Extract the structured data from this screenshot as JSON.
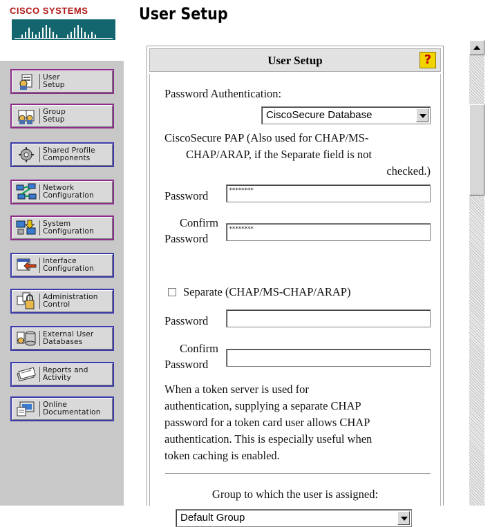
{
  "brand": {
    "name": "Cisco Systems"
  },
  "page_title": "User Setup",
  "nav": {
    "items": [
      {
        "label": "User\nSetup",
        "icon": "user-setup-icon"
      },
      {
        "label": "Group\nSetup",
        "icon": "group-setup-icon"
      },
      {
        "label": "Shared Profile\nComponents",
        "icon": "shared-profile-icon"
      },
      {
        "label": "Network\nConfiguration",
        "icon": "network-config-icon"
      },
      {
        "label": "System\nConfiguration",
        "icon": "system-config-icon"
      },
      {
        "label": "Interface\nConfiguration",
        "icon": "interface-config-icon"
      },
      {
        "label": "Administration\nControl",
        "icon": "admin-control-icon"
      },
      {
        "label": "External User\nDatabases",
        "icon": "external-db-icon"
      },
      {
        "label": "Reports and\nActivity",
        "icon": "reports-icon"
      },
      {
        "label": "Online\nDocumentation",
        "icon": "online-doc-icon"
      }
    ]
  },
  "panel": {
    "header": "User Setup",
    "help_glyph": "?",
    "auth_label": "Password Authentication:",
    "auth_select": "CiscoSecure Database",
    "pap_line1": "CiscoSecure PAP (Also used for CHAP/MS-",
    "pap_line2": "CHAP/ARAP, if the Separate field is not",
    "pap_line3": "checked.)",
    "password_label": "Password",
    "password_value": "********",
    "confirm_label_line1": "Confirm",
    "confirm_label_line2": "Password",
    "confirm_value": "********",
    "separate_label": "Separate (CHAP/MS-CHAP/ARAP)",
    "sep_password_label": "Password",
    "sep_password_value": "",
    "sep_confirm_line1": "Confirm",
    "sep_confirm_line2": "Password",
    "sep_confirm_value": "",
    "token_lines": [
      "When a token server is used for",
      "authentication, supplying a separate CHAP",
      "password for a token card user allows CHAP",
      "authentication. This is especially useful when",
      "token caching is enabled."
    ],
    "group_label": "Group to which the user is assigned:",
    "group_select": "Default Group"
  },
  "colors": {
    "nav_bg": "#c8c8c8",
    "brand_red": "#b01818",
    "help_yellow": "#f2d400"
  }
}
